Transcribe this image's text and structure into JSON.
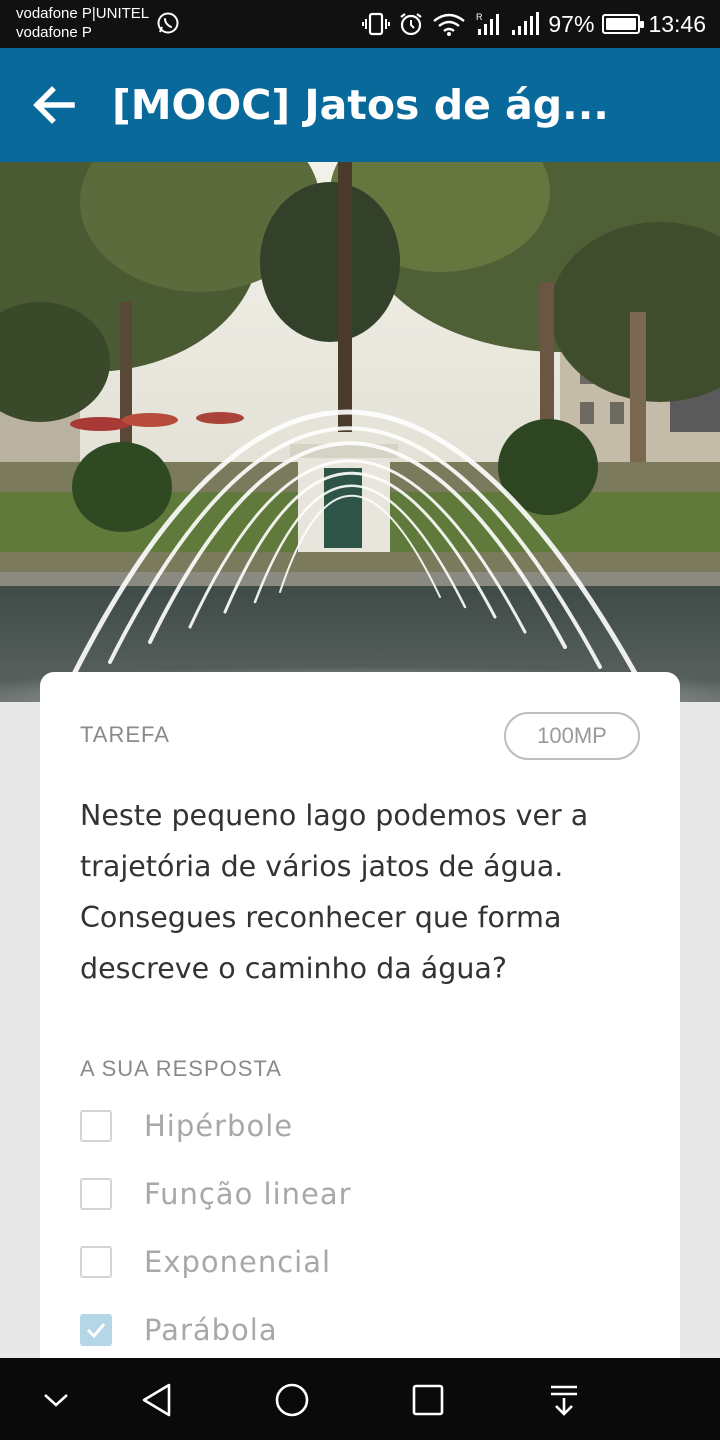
{
  "status_bar": {
    "carrier_1": "vodafone P|UNITEL",
    "carrier_2": "vodafone P",
    "battery_percent": "97%",
    "battery_level": 0.97,
    "time": "13:46"
  },
  "app_bar": {
    "title": "[MOOC] Jatos de ág..."
  },
  "task": {
    "label": "TAREFA",
    "points": "100MP",
    "question": "Neste pequeno lago podemos ver a trajetória de vários jatos de água. Consegues reconhecer que forma descreve o caminho da água?"
  },
  "answer": {
    "label": "A SUA RESPOSTA",
    "options": [
      {
        "label": "Hipérbole",
        "checked": false
      },
      {
        "label": "Função linear",
        "checked": false
      },
      {
        "label": "Exponencial",
        "checked": false
      },
      {
        "label": "Parábola",
        "checked": true
      }
    ]
  },
  "colors": {
    "app_bar": "#08699a",
    "checkbox_checked": "#b5d6e6"
  }
}
